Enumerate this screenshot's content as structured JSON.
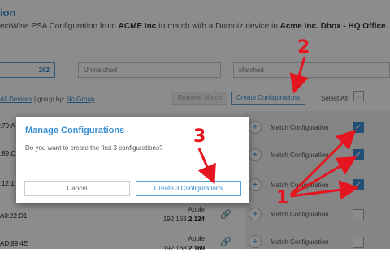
{
  "header": {
    "title_fragment": "ion",
    "subtitle_prefix": "ectWise PSA Configuration from ",
    "subtitle_source": "ACME Inc",
    "subtitle_middle": " to match with a Domotz device in ",
    "subtitle_target": "Acme Inc. Dbox - HQ Office"
  },
  "filters": {
    "all_count": "262",
    "unmatched_label": "Unmatched",
    "matched_label": "Matched"
  },
  "toolbar": {
    "all_devices_link": "All Devices",
    "group_by_label": "| group by:",
    "no_group_link": "No Group",
    "remove_match_label": "Remove Match",
    "create_configurations_label": "Create Configurations",
    "select_all_label": "Select All",
    "select_all_state": "–"
  },
  "devices": [
    {
      "mac": ":79:A",
      "vendor": "",
      "ip_prefix": "",
      "ip_suffix": "",
      "action": "Match Configuration",
      "checked": true
    },
    {
      "mac": ":89:C",
      "vendor": "",
      "ip_prefix": "",
      "ip_suffix": "",
      "action": "Match Configuration",
      "checked": true
    },
    {
      "mac": ":12:1",
      "vendor": "",
      "ip_prefix": "",
      "ip_suffix": "",
      "action": "Match Configuration",
      "checked": true
    },
    {
      "mac": "A0:22:D1",
      "vendor": "Apple",
      "ip_prefix": "192.168.",
      "ip_suffix": "2.124",
      "action": "Match Configuration",
      "checked": false
    },
    {
      "mac": "AD:99:4E",
      "vendor": "Apple",
      "ip_prefix": "192.168.",
      "ip_suffix": "2.169",
      "action": "Match Configuration",
      "checked": false
    }
  ],
  "icons": {
    "check": "✓",
    "plus": "+",
    "chain": "🔗"
  },
  "modal": {
    "title": "Manage Configurations",
    "message": "Do you want to create the first 3 configurations?",
    "cancel_label": "Cancel",
    "create_label": "Create 3 Configurations"
  },
  "annotations": {
    "step1": "1",
    "step2": "2",
    "step3": "3",
    "color": "#e5151f"
  }
}
